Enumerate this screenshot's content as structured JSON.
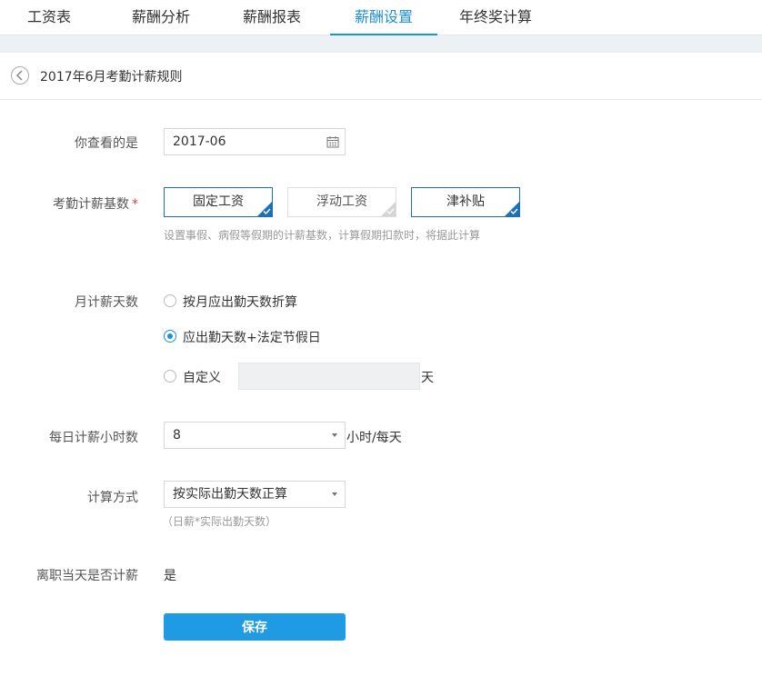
{
  "tabs": [
    {
      "label": "工资表",
      "active": false
    },
    {
      "label": "薪酬分析",
      "active": false
    },
    {
      "label": "薪酬报表",
      "active": false
    },
    {
      "label": "薪酬设置",
      "active": true
    },
    {
      "label": "年终奖计算",
      "active": false
    }
  ],
  "page": {
    "title": "2017年6月考勤计薪规则"
  },
  "colors": {
    "accent": "#1e8fd8",
    "button": "#1e9be3",
    "required": "#e03b3b"
  },
  "form": {
    "month": {
      "label": "你查看的是",
      "value": "2017-06",
      "icon": "calendar-icon"
    },
    "base": {
      "label": "考勤计薪基数",
      "required_mark": "*",
      "options": [
        {
          "label": "固定工资",
          "selected": true
        },
        {
          "label": "浮动工资",
          "selected": false
        },
        {
          "label": "津补贴",
          "selected": true
        }
      ],
      "hint": "设置事假、病假等假期的计薪基数，计算假期扣款时，将据此计算"
    },
    "days": {
      "label": "月计薪天数",
      "options": [
        {
          "label": "按月应出勤天数折算",
          "selected": false
        },
        {
          "label": "应出勤天数+法定节假日",
          "selected": true
        },
        {
          "label": "自定义",
          "selected": false
        }
      ],
      "custom_value": "",
      "unit": "天"
    },
    "hours": {
      "label": "每日计薪小时数",
      "value": "8",
      "unit": "小时/每天"
    },
    "method": {
      "label": "计算方式",
      "value": "按实际出勤天数正算",
      "hint": "（日薪*实际出勤天数）"
    },
    "leave_day": {
      "label": "离职当天是否计薪",
      "value": "是"
    },
    "save_label": "保存"
  }
}
